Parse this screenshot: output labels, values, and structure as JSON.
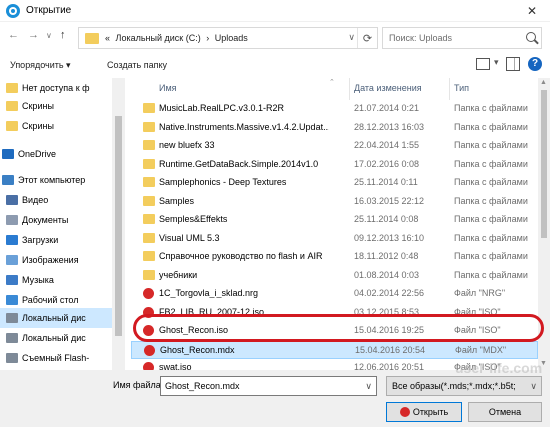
{
  "window": {
    "title": "Открытие",
    "close_glyph": "✕"
  },
  "nav": {
    "back": "←",
    "forward": "→",
    "up_dropdown": "∨",
    "up": "↑"
  },
  "address": {
    "prefix": "«",
    "path_drive": "Локальный диск (C:)",
    "separator": "›",
    "path_folder": "Uploads",
    "dropdown": "∨",
    "refresh": "⟳"
  },
  "search": {
    "placeholder": "Поиск: Uploads"
  },
  "toolbar": {
    "organize_label": "Упорядочить ▾",
    "new_folder_label": "Создать папку",
    "view_drop": "▾",
    "help": "?"
  },
  "sidebar": {
    "items": [
      {
        "label": "Нет доступа к ф",
        "icon": "folder-icon",
        "color": "#f3cd5d"
      },
      {
        "label": "Скрины",
        "icon": "folder-icon",
        "color": "#f3cd5d"
      },
      {
        "label": "Скрины",
        "icon": "folder-icon",
        "color": "#f3cd5d"
      },
      {
        "label": "OneDrive",
        "icon": "cloud-icon",
        "color": "#1e6bbf"
      },
      {
        "label": "Этот компьютер",
        "icon": "computer-icon",
        "color": "#3a7fc4"
      },
      {
        "label": "Видео",
        "icon": "video-icon",
        "color": "#4a6fa5"
      },
      {
        "label": "Документы",
        "icon": "documents-icon",
        "color": "#8d9bb0"
      },
      {
        "label": "Загрузки",
        "icon": "downloads-icon",
        "color": "#2a7bd1"
      },
      {
        "label": "Изображения",
        "icon": "pictures-icon",
        "color": "#6aa0d8"
      },
      {
        "label": "Музыка",
        "icon": "music-icon",
        "color": "#3c7bc7"
      },
      {
        "label": "Рабочий стол",
        "icon": "desktop-icon",
        "color": "#3a8ad6"
      },
      {
        "label": "Локальный дис",
        "icon": "drive-icon",
        "color": "#7e8a98"
      },
      {
        "label": "Локальный дис",
        "icon": "drive-icon",
        "color": "#7e8a98"
      },
      {
        "label": "Съемный Flash-",
        "icon": "usb-drive-icon",
        "color": "#7e8a98"
      }
    ]
  },
  "columns": {
    "name": "Имя",
    "date": "Дата изменения",
    "type": "Тип",
    "sort_arrow": "⌃"
  },
  "files": [
    {
      "name": "MusicLab.RealLPC.v3.0.1-R2R",
      "date": "21.07.2014 0:21",
      "type": "Папка с файлами",
      "kind": "folder"
    },
    {
      "name": "Native.Instruments.Massive.v1.4.2.Updat...",
      "date": "28.12.2013 16:03",
      "type": "Папка с файлами",
      "kind": "folder"
    },
    {
      "name": "new bluefx 33",
      "date": "22.04.2014 1:55",
      "type": "Папка с файлами",
      "kind": "folder"
    },
    {
      "name": "Runtime.GetDataBack.Simple.2014v1.0",
      "date": "17.02.2016 0:08",
      "type": "Папка с файлами",
      "kind": "folder"
    },
    {
      "name": "Samplephonics - Deep Textures",
      "date": "25.11.2014 0:11",
      "type": "Папка с файлами",
      "kind": "folder"
    },
    {
      "name": "Samples",
      "date": "16.03.2015 22:12",
      "type": "Папка с файлами",
      "kind": "folder"
    },
    {
      "name": "Semples&Effekts",
      "date": "25.11.2014 0:08",
      "type": "Папка с файлами",
      "kind": "folder"
    },
    {
      "name": "Visual UML 5.3",
      "date": "09.12.2013 16:10",
      "type": "Папка с файлами",
      "kind": "folder"
    },
    {
      "name": "Справочное руководство по flash и AIR",
      "date": "18.11.2012 0:48",
      "type": "Папка с файлами",
      "kind": "folder"
    },
    {
      "name": "учебники",
      "date": "01.08.2014 0:03",
      "type": "Папка с файлами",
      "kind": "folder"
    },
    {
      "name": "1C_Torgovla_i_sklad.nrg",
      "date": "04.02.2014 22:56",
      "type": "Файл \"NRG\"",
      "kind": "file"
    },
    {
      "name": "FB2_LIB_RU_2007-12.iso",
      "date": "03.12.2015 8:53",
      "type": "Файл \"ISO\"",
      "kind": "file"
    },
    {
      "name": "Ghost_Recon.iso",
      "date": "15.04.2016 19:25",
      "type": "Файл \"ISO\"",
      "kind": "file"
    },
    {
      "name": "Ghost_Recon.mdx",
      "date": "15.04.2016 20:54",
      "type": "Файл \"MDX\"",
      "kind": "file",
      "selected": true
    },
    {
      "name": "swat.iso",
      "date": "12.06.2016 20:51",
      "type": "Файл \"ISO\"",
      "kind": "file"
    }
  ],
  "footer": {
    "filename_label": "Имя файла:",
    "filename_value": "Ghost_Recon.mdx",
    "filename_drop": "∨",
    "filter_value": "Все образы(*.mds;*.mdx;*.b5t;",
    "filter_drop": "∨",
    "open_label": "Открыть",
    "cancel_label": "Отмена"
  },
  "watermark": "user-life.com",
  "colors": {
    "accent": "#0078d7",
    "selection": "#cce8ff",
    "highlight_ring": "#d21920",
    "folder": "#f3cd5d"
  }
}
